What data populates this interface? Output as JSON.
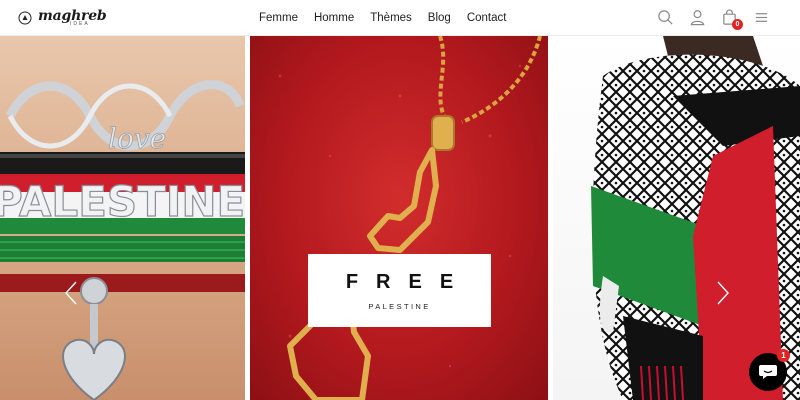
{
  "brand": {
    "name": "maghreb",
    "tagline": "IDEA"
  },
  "nav": {
    "items": [
      "Femme",
      "Homme",
      "Thèmes",
      "Blog",
      "Contact"
    ]
  },
  "header_icons": {
    "search": "search-icon",
    "account": "user-icon",
    "cart": "cart-icon",
    "cart_count": "0",
    "menu": "menu-icon"
  },
  "hero": {
    "slides": [
      {
        "product": "PALESTINE bracelet",
        "text": "PALESTINE",
        "charm_text": "love"
      },
      {
        "product": "Palestine map necklace"
      },
      {
        "product": "Keffiyeh flag scarf"
      }
    ],
    "overlay": {
      "title": "FREE",
      "subtitle": "PALESTINE"
    },
    "prev_arrow": "chevron-left-icon",
    "next_arrow": "chevron-right-icon"
  },
  "chat": {
    "icon": "chat-icon",
    "badge": "1"
  },
  "colors": {
    "flag_red": "#c8102e",
    "flag_green": "#1f8a3a",
    "flag_black": "#111111",
    "badge_red": "#e02424",
    "gold": "#d9a441"
  }
}
